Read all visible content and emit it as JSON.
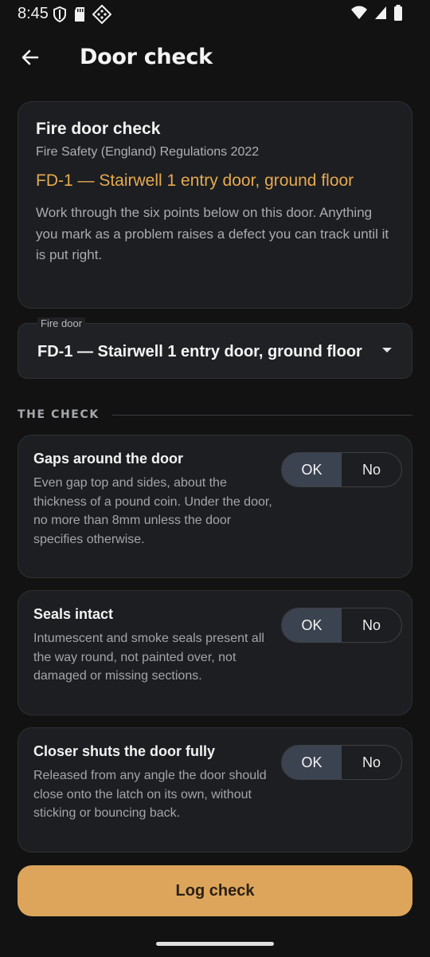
{
  "status": {
    "time": "8:45"
  },
  "app_bar": {
    "title": "Door check"
  },
  "intro": {
    "title": "Fire door check",
    "regulation": "Fire Safety (England) Regulations 2022",
    "door": "FD-1 — Stairwell 1 entry door, ground floor",
    "description": "Work through the six points below on this door. Anything you mark as a problem raises a defect you can track until it is put right."
  },
  "door_select": {
    "label": "Fire door",
    "value": "FD-1 — Stairwell 1 entry door, ground floor"
  },
  "section": {
    "label": "THE CHECK"
  },
  "checks": [
    {
      "title": "Gaps around the door",
      "description": "Even gap top and sides, about the thickness of a pound coin. Under the door, no more than 8mm unless the door specifies otherwise.",
      "ok_label": "OK",
      "no_label": "No",
      "selected": "OK"
    },
    {
      "title": "Seals intact",
      "description": "Intumescent and smoke seals present all the way round, not painted over, not damaged or missing sections.",
      "ok_label": "OK",
      "no_label": "No",
      "selected": "OK"
    },
    {
      "title": "Closer shuts the door fully",
      "description": "Released from any angle the door should close onto the latch on its own, without sticking or bouncing back.",
      "ok_label": "OK",
      "no_label": "No",
      "selected": "OK"
    }
  ],
  "primary_action": {
    "label": "Log check"
  },
  "colors": {
    "accent": "#DCA55B",
    "door_text": "#E6A94F",
    "background": "#121212",
    "card": "#1C1E21",
    "selected_toggle": "#3C4350"
  }
}
